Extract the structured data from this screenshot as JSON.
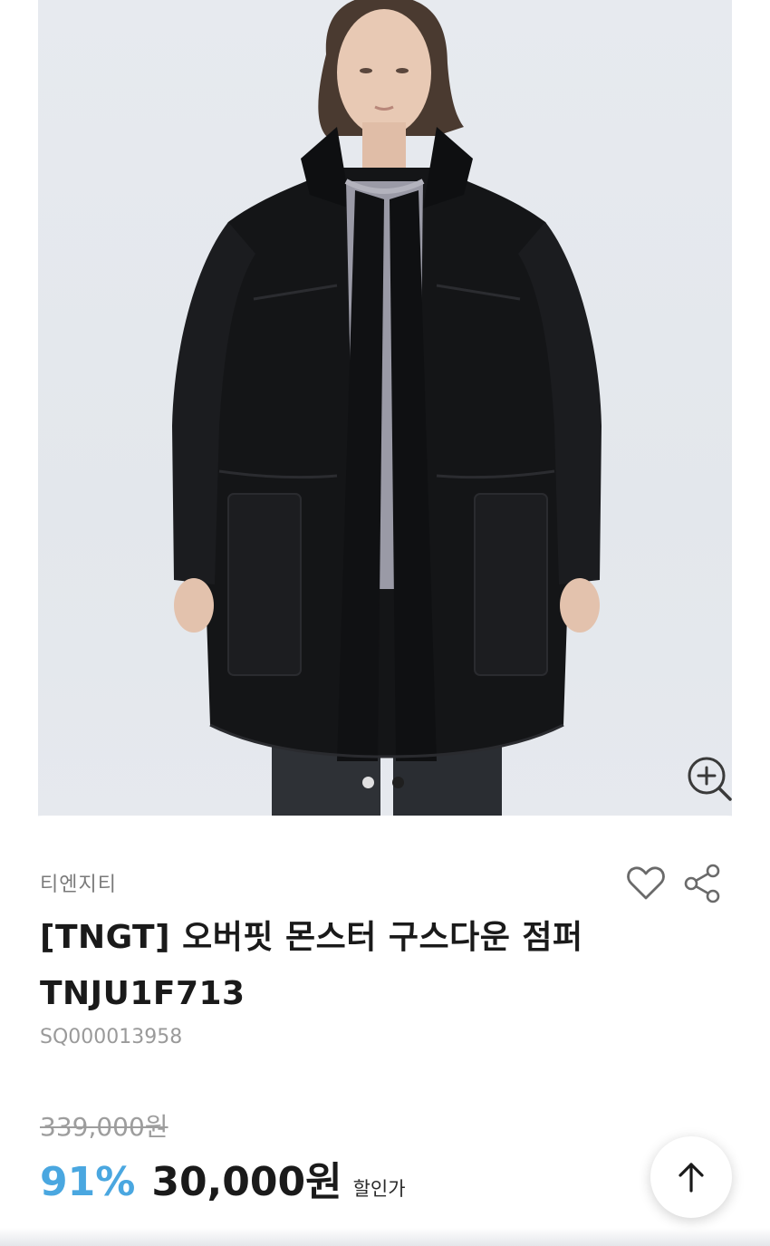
{
  "product": {
    "brand": "티엔지티",
    "title": "[TNGT] 오버핏 몬스터 구스다운 점퍼 TNJU1F713",
    "sku": "SQ000013958",
    "original_price": "339,000원",
    "discount_rate": "91%",
    "sale_price": "30,000원",
    "sale_price_label": "할인가"
  },
  "gallery": {
    "image_count": 2,
    "active_index": 1
  },
  "icons": {
    "zoom": "zoom-in-icon",
    "wishlist": "heart-icon",
    "share": "share-icon",
    "scroll_top": "arrow-up-icon"
  },
  "colors": {
    "discount": "#4aa7e0",
    "text": "#1a1a1a",
    "muted": "#9a9a9a"
  }
}
